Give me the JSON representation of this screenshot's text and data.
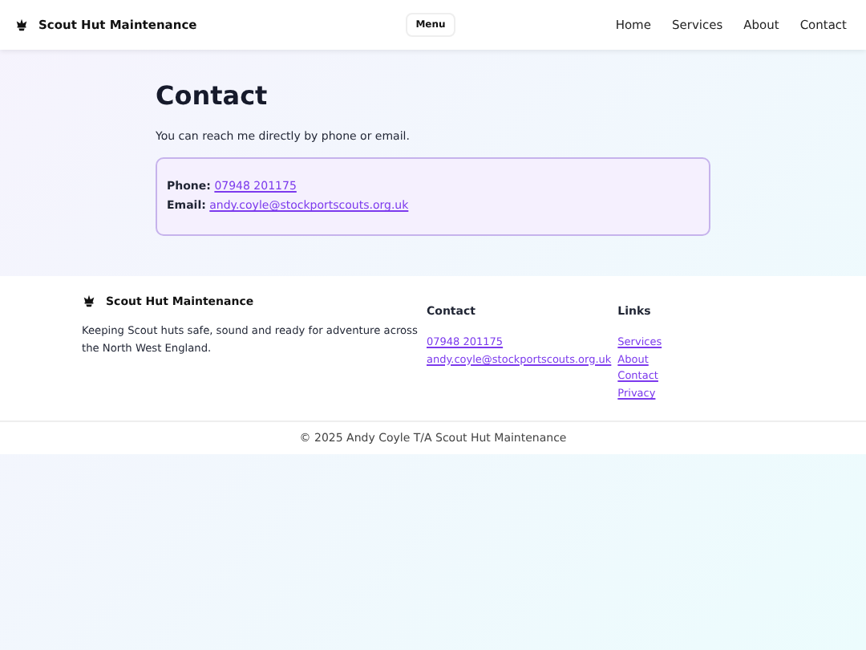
{
  "header": {
    "brand": "Scout Hut Maintenance",
    "menu_button": "Menu",
    "nav": [
      "Home",
      "Services",
      "About",
      "Contact"
    ]
  },
  "main": {
    "title": "Contact",
    "intro": "You can reach me directly by phone or email.",
    "details": [
      {
        "label": "Phone:",
        "value": "07948 201175"
      },
      {
        "label": "Email:",
        "value": "andy.coyle@stockportscouts.org.uk"
      }
    ]
  },
  "footer": {
    "brand": "Scout Hut Maintenance",
    "tagline": "Keeping Scout huts safe, sound and ready for adventure across the North West England.",
    "contact_heading": "Contact",
    "contact_links": [
      "07948 201175",
      "andy.coyle@stockportscouts.org.uk"
    ],
    "links_heading": "Links",
    "links": [
      "Services",
      "About",
      "Contact",
      "Privacy"
    ]
  },
  "copyright": "© 2025 Andy Coyle T/A Scout Hut Maintenance"
}
